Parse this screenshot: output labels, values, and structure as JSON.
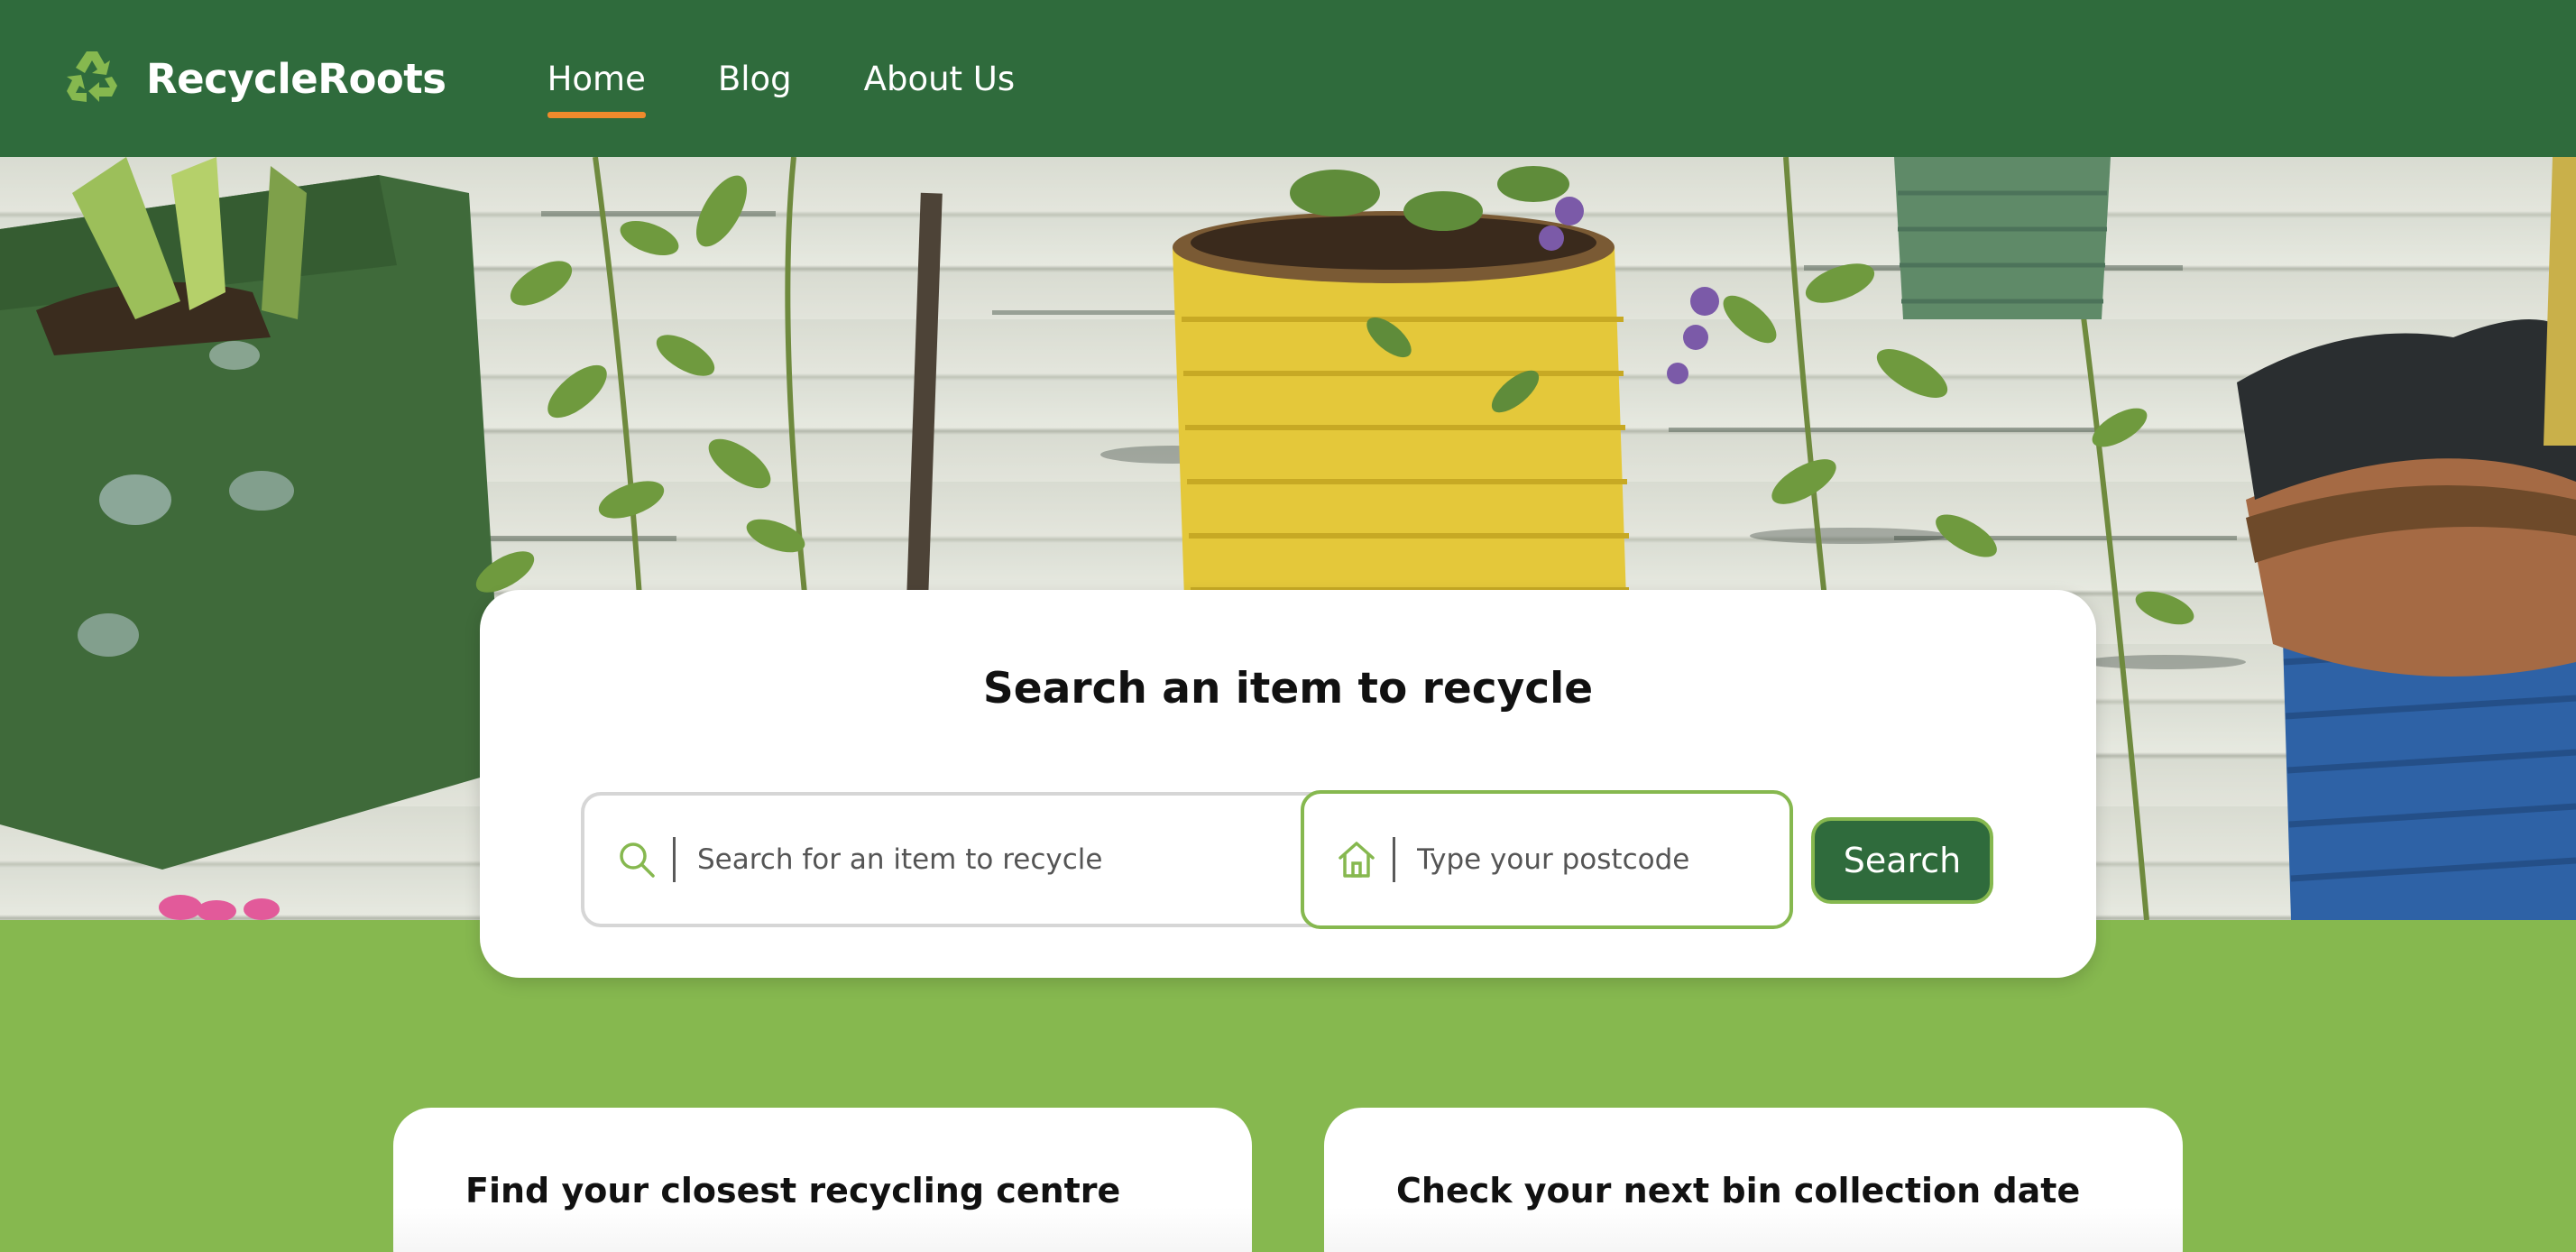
{
  "brand": {
    "name": "RecycleRoots",
    "logo_icon": "recycle-icon"
  },
  "nav": {
    "items": [
      {
        "label": "Home",
        "active": true
      },
      {
        "label": "Blog",
        "active": false
      },
      {
        "label": "About Us",
        "active": false
      }
    ]
  },
  "search": {
    "title": "Search an item to recycle",
    "item_placeholder": "Search for an item to recycle",
    "item_value": "",
    "postcode_placeholder": "Type your postcode",
    "postcode_value": "",
    "button_label": "Search"
  },
  "cards": [
    {
      "title": "Find your closest recycling centre"
    },
    {
      "title": "Check your next bin collection date"
    }
  ],
  "colors": {
    "header_bg": "#2f6b3c",
    "accent_green": "#86b84f",
    "active_underline": "#ef8a2c",
    "button_bg": "#2f6b3c"
  }
}
